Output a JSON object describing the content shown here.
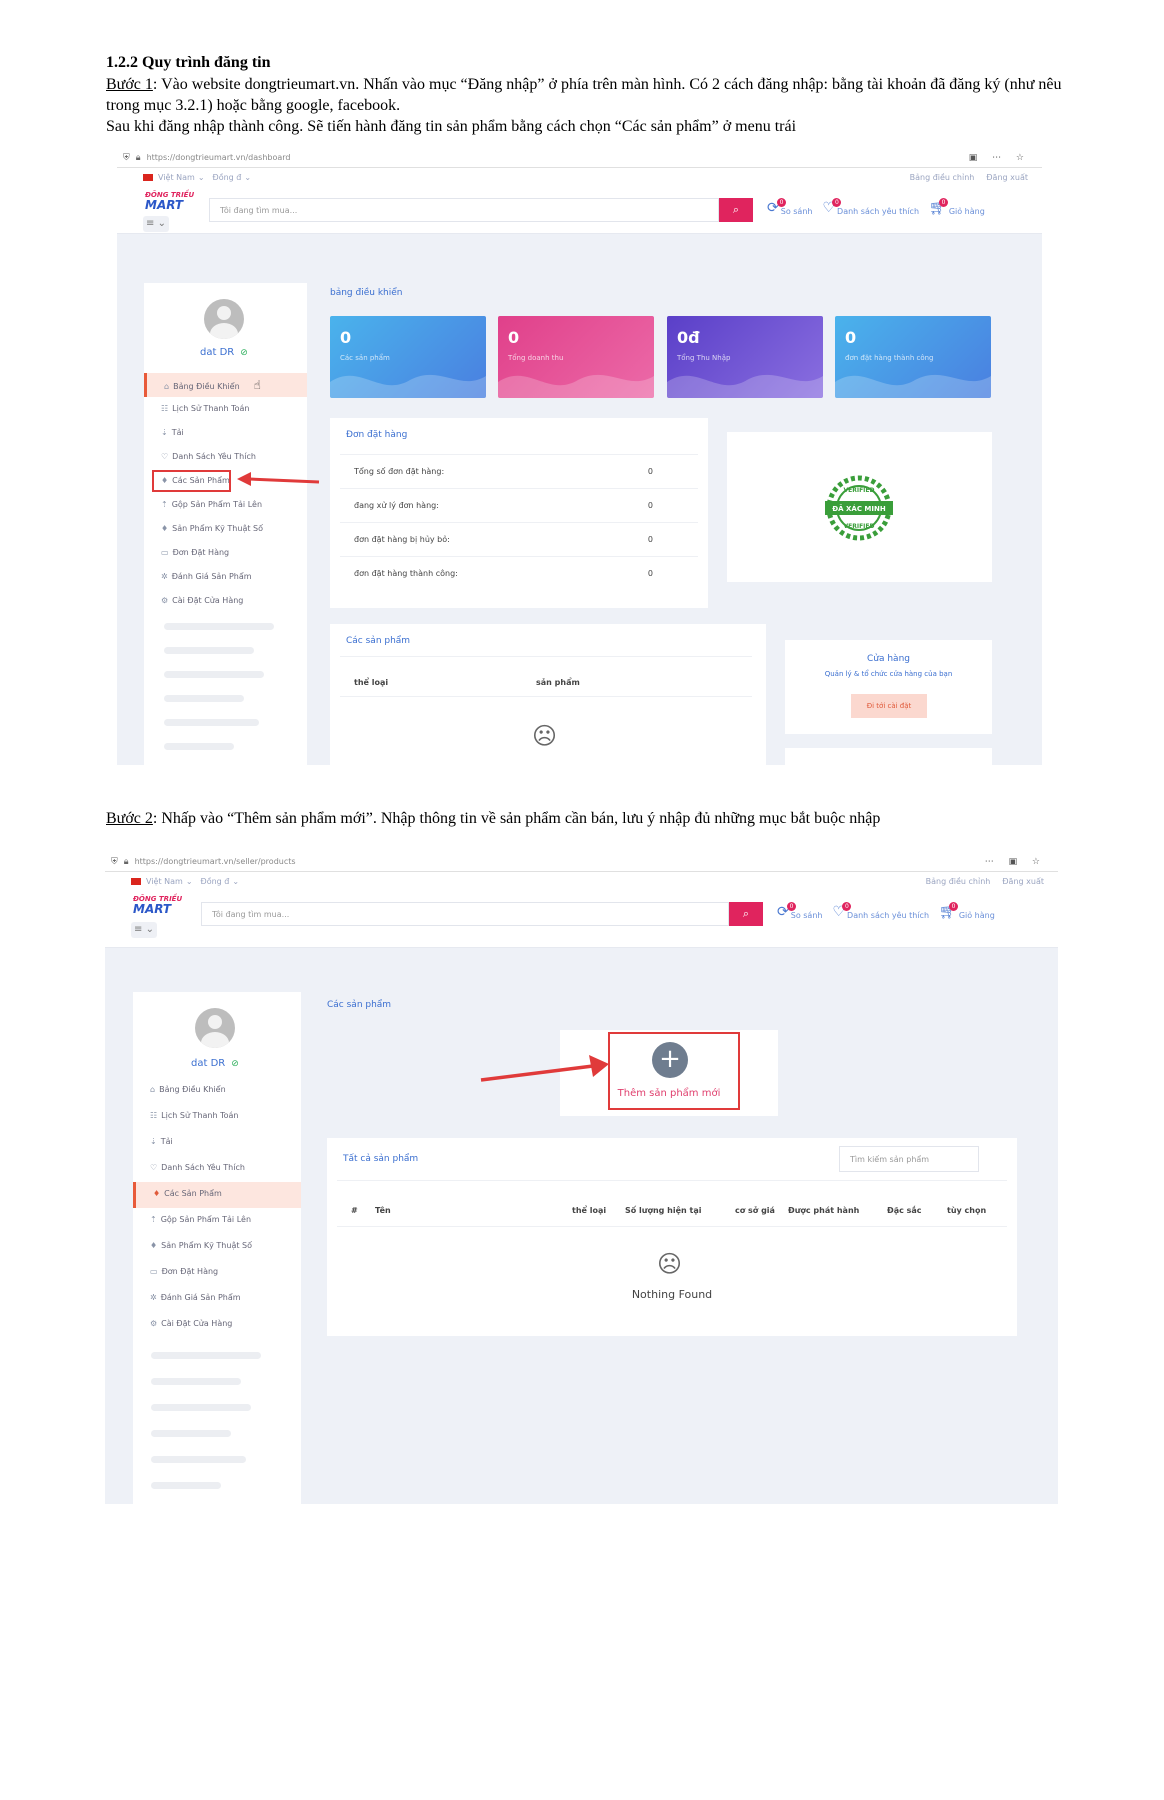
{
  "doc": {
    "heading": "1.2.2 Quy trình đăng tin",
    "step1_label": "Bước 1",
    "step1_text": ": Vào website dongtrieumart.vn. Nhấn vào mục “Đăng nhập” ở phía trên màn hình. Có 2 cách đăng nhập: bằng tài khoản đã đăng ký (như nêu trong mục 3.2.1) hoặc bằng google, facebook.",
    "step1_text2": "Sau khi đăng nhập thành công. Sẽ tiến hành đăng tin sản phẩm bằng cách chọn “Các sản phẩm” ở menu trái",
    "step2_label": "Bước 2",
    "step2_text": ": Nhấp vào “Thêm sản phẩm mới”. Nhập thông tin về sản phẩm cần  bán, lưu ý nhập đủ những mục bắt buộc nhập"
  },
  "site": {
    "lang": "Việt Nam",
    "currency": "Đồng đ",
    "dashboard_link": "Bảng điều chỉnh",
    "logout": "Đăng xuất",
    "logo_line1": "ĐÔNG TRIỀU",
    "logo_line2": "MART",
    "search_placeholder": "Tôi đang tìm mua...",
    "compare": "So sánh",
    "wishlist": "Danh sách yêu thích",
    "cart": "Giỏ hàng",
    "badge": "0",
    "user": "dat DR",
    "menu": [
      "Bảng Điều Khiển",
      "Lịch Sử Thanh Toán",
      "Tải",
      "Danh Sách Yêu Thích",
      "Các Sản Phẩm",
      "Gộp Sản Phẩm Tải Lên",
      "Sản Phẩm Kỹ Thuật Số",
      "Đơn Đặt Hàng",
      "Đánh Giá Sản Phẩm",
      "Cài Đặt Cửa Hàng"
    ]
  },
  "shot1": {
    "url": "https://dongtrieumart.vn/dashboard",
    "title": "bảng điều khiển",
    "stats": [
      {
        "value": "0",
        "label": "Các sản phẩm",
        "color": "#4aa3e8"
      },
      {
        "value": "0",
        "label": "Tổng doanh thu",
        "color": "#e0408a"
      },
      {
        "value": "0đ",
        "label": "Tổng Thu Nhập",
        "color": "#6a4fd0"
      },
      {
        "value": "0",
        "label": "đơn đặt hàng thành công",
        "color": "#4aa3e8"
      }
    ],
    "orders_title": "Đơn đặt hàng",
    "orders": [
      {
        "label": "Tổng số đơn đặt hàng:",
        "value": "0"
      },
      {
        "label": "đang xử lý đơn hàng:",
        "value": "0"
      },
      {
        "label": "đơn đặt hàng bị hủy bỏ:",
        "value": "0"
      },
      {
        "label": "đơn đặt hàng thành công:",
        "value": "0"
      }
    ],
    "verified_text": "ĐÃ XÁC MINH",
    "verified_word": "VERIFIED",
    "products_title": "Các sản phẩm",
    "col_category": "thể loại",
    "col_product": "sản phẩm",
    "shop_title": "Cửa hàng",
    "shop_sub": "Quản lý & tổ chức cửa hàng của bạn",
    "shop_btn": "Đi tới cài đặt"
  },
  "shot2": {
    "url": "https://dongtrieumart.vn/seller/products",
    "title": "Các sản phẩm",
    "add_label": "Thêm sản phẩm mới",
    "all_title": "Tất cả sản phẩm",
    "search_placeholder": "Tìm kiếm sản phẩm",
    "columns": [
      "#",
      "Tên",
      "thể loại",
      "Số lượng hiện tại",
      "cơ sở giá",
      "Được phát hành",
      "Đặc sắc",
      "tùy chọn"
    ],
    "empty": "Nothing Found"
  }
}
